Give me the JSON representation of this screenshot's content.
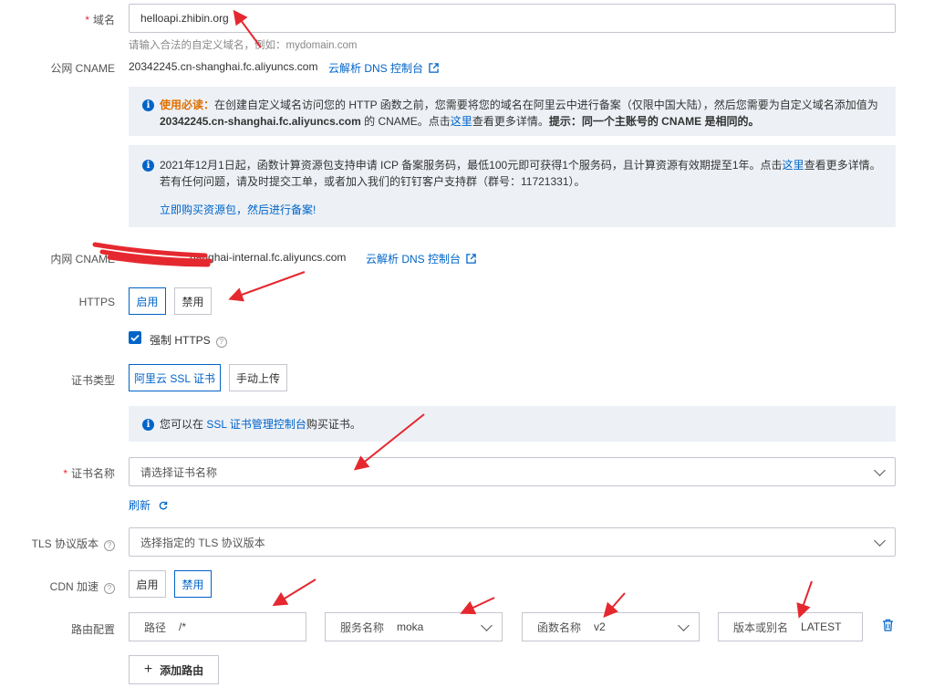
{
  "domain": {
    "label": "域名",
    "value": "helloapi.zhibin.org",
    "hint": "请输入合法的自定义域名，例如：mydomain.com"
  },
  "public_cname": {
    "label": "公网 CNAME",
    "value": "20342245.cn-shanghai.fc.aliyuncs.com",
    "dns_link": "云解析 DNS 控制台"
  },
  "notice1": {
    "emph": "使用必读：",
    "text_a": "在创建自定义域名访问您的 HTTP 函数之前，您需要将您的域名在阿里云中进行备案（仅限中国大陆），然后您需要为自定义域名添加值为",
    "cname": "20342245.cn-shanghai.fc.aliyuncs.com",
    "text_b": " 的 CNAME。点击",
    "here": "这里",
    "text_c": "查看更多详情。",
    "tip": "提示：同一个主账号的 CNAME 是相同的。"
  },
  "notice2": {
    "text_a": "2021年12月1日起，函数计算资源包支持申请 ICP 备案服务码，最低100元即可获得1个服务码，且计算资源有效期提至1年。点击",
    "here": "这里",
    "text_b": "查看更多详情。若有任何问题，请及时提交工单，或者加入我们的钉钉客户支持群（群号：11721331）。",
    "buy_link": "立即购买资源包，然后进行备案!"
  },
  "internal_cname": {
    "label": "内网 CNAME",
    "value": "hanghai-internal.fc.aliyuncs.com",
    "dns_link": "云解析 DNS 控制台"
  },
  "https": {
    "label": "HTTPS",
    "enable": "启用",
    "disable": "禁用",
    "force_label": "强制 HTTPS"
  },
  "cert_type": {
    "label": "证书类型",
    "aliyun": "阿里云 SSL 证书",
    "manual": "手动上传"
  },
  "notice3": {
    "text_a": "您可以在 ",
    "link": "SSL 证书管理控制台",
    "text_b": "购买证书。"
  },
  "cert_name": {
    "label": "证书名称",
    "placeholder": "请选择证书名称",
    "refresh": "刷新"
  },
  "tls": {
    "label": "TLS 协议版本",
    "placeholder": "选择指定的 TLS 协议版本"
  },
  "cdn": {
    "label": "CDN 加速",
    "enable": "启用",
    "disable": "禁用"
  },
  "route": {
    "label": "路由配置",
    "path_label": "路径",
    "path_value": "/*",
    "service_label": "服务名称",
    "service_value": "moka",
    "function_label": "函数名称",
    "function_value": "v2",
    "version_label": "版本或别名",
    "version_value": "LATEST",
    "add_label": "添加路由"
  },
  "colors": {
    "accent": "#0064c8",
    "annotation": "#e5282f",
    "notice_bg": "#edf1f6"
  }
}
